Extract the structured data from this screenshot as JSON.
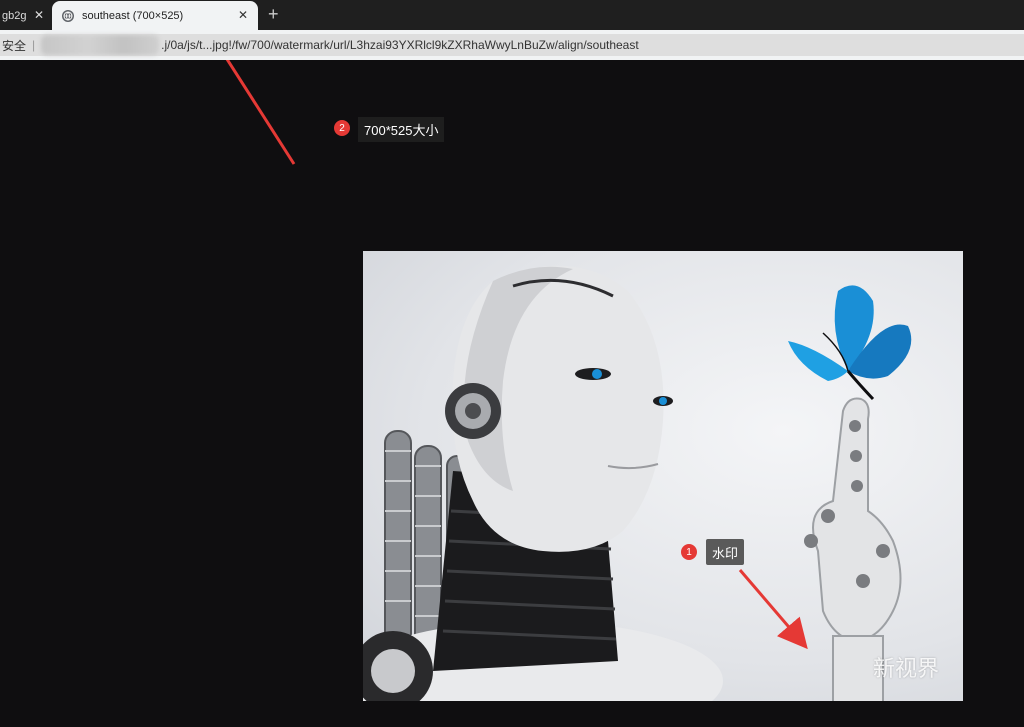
{
  "tabs": [
    {
      "title": "gb2g",
      "active": false
    },
    {
      "title": "southeast (700×525)",
      "active": true
    }
  ],
  "address": {
    "security_label": "安全",
    "url_text": ".j/0a/js/t...jpg!/fw/700/watermark/url/L3hzai93YXRlcl9kZXRhaWwyLnBuZw/align/southeast"
  },
  "annotations": [
    {
      "number": "2",
      "label": "700*525大小"
    },
    {
      "number": "1",
      "label": "水印"
    }
  ],
  "photo": {
    "watermark_text": "新视界"
  },
  "colors": {
    "annotation_red": "#e53935",
    "butterfly_blue": "#1a8fd6"
  }
}
